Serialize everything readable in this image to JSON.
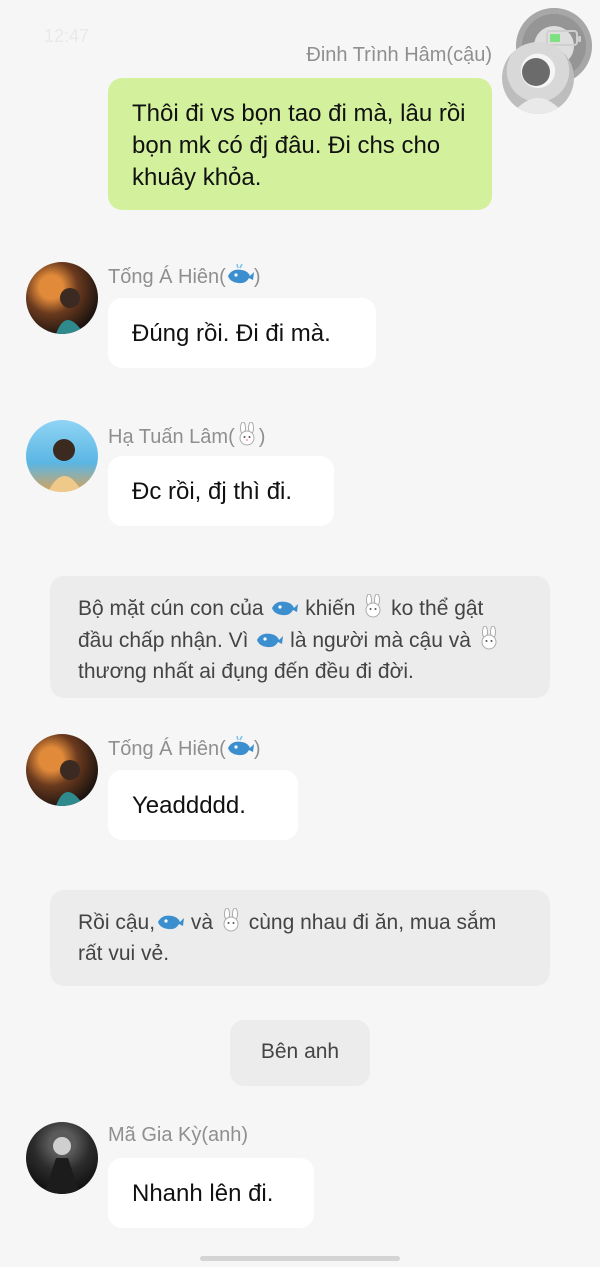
{
  "status": {
    "time": "12:47"
  },
  "messages": [
    {
      "name": "Đinh Trình Hâm(cậu)",
      "text": "Thôi đi vs bọn tao đi mà, lâu rồi bọn mk có đj đâu. Đi chs cho khuây khỏa."
    },
    {
      "name": "Tống Á Hiên(",
      "name_end": ")",
      "name_emoji": "whale-icon",
      "text": "Đúng rồi. Đi đi mà."
    },
    {
      "name": "Hạ Tuấn Lâm(",
      "name_end": ")",
      "name_emoji": "rabbit-icon",
      "text": "Đc rồi, đj thì đi."
    },
    {
      "name": "Tống Á Hiên(",
      "name_end": ")",
      "name_emoji": "whale-icon",
      "text": "Yeaddddd."
    },
    {
      "name": "Mã Gia Kỳ(anh)",
      "text": "Nhanh lên đi."
    }
  ],
  "narration1": {
    "a": "Bộ mặt cún con của ",
    "b": " khiến ",
    "c": " ko thể gật đầu chấp nhận. Vì ",
    "d": " là người mà cậu và ",
    "e": " thương nhất ai đụng đến đều đi đời."
  },
  "narration2": {
    "a": "Rồi cậu,",
    "b": " và ",
    "c": " cùng nhau đi ăn, mua sắm rất vui vẻ."
  },
  "scene_label": "Bên anh",
  "colors": {
    "background": "#f6f6f6",
    "my_bubble": "#d3f19c",
    "other_bubble": "#ffffff",
    "narration": "#ececec"
  }
}
